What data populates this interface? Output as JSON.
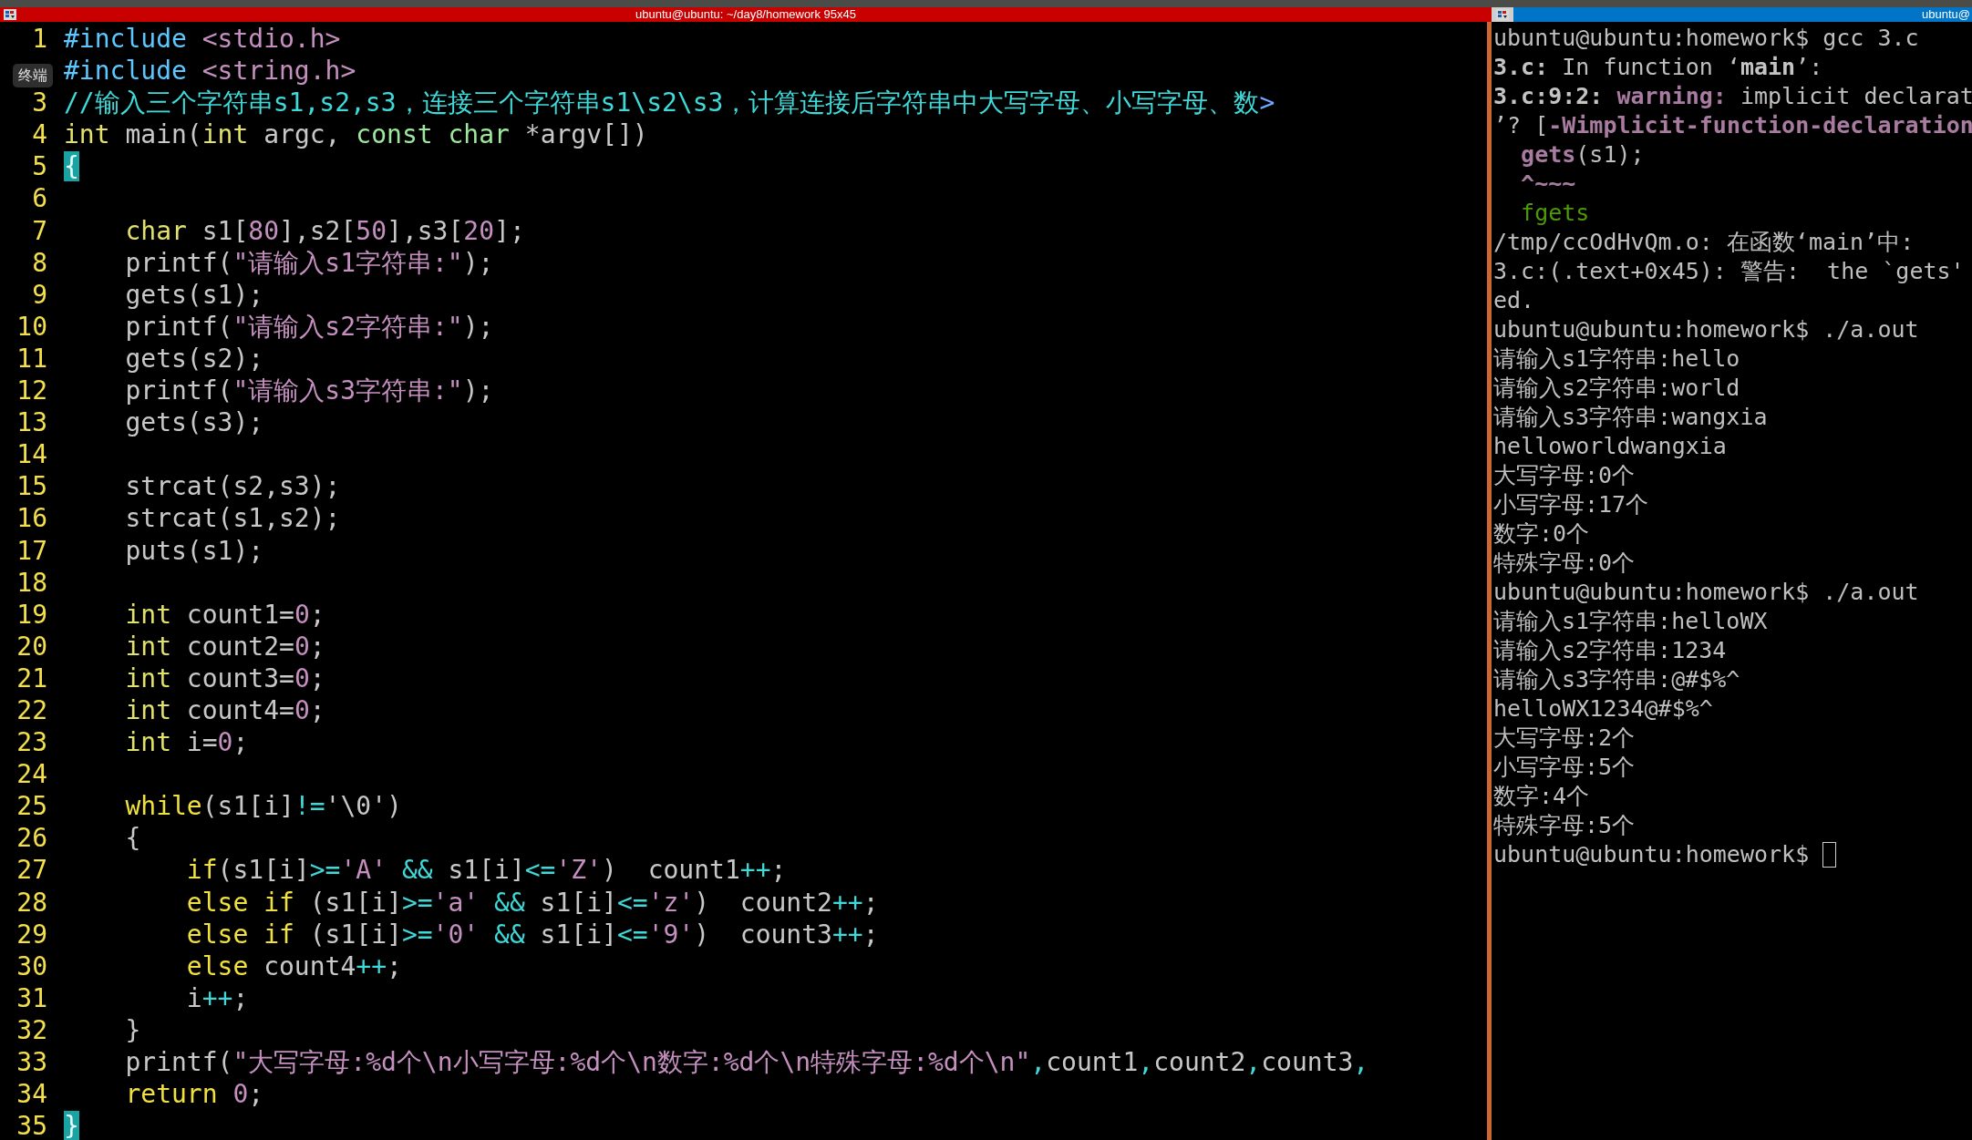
{
  "left_pane": {
    "title": "ubuntu@ubuntu: ~/day8/homework 95x45",
    "tooltip": "终端",
    "lines": [
      {
        "number": "1",
        "current": false,
        "segments": [
          {
            "kind": "pp",
            "text": "#include"
          },
          {
            "kind": "inc",
            "text": " <stdio.h>"
          }
        ]
      },
      {
        "current": false,
        "segments": [
          {
            "kind": "pp",
            "text": "#include"
          },
          {
            "kind": "inc",
            "text": " <string.h>"
          }
        ]
      },
      {
        "number": "3",
        "current": false,
        "segments": [
          {
            "kind": "cm",
            "text": "//输入三个字符串s1,s2,s3，连接三个字符串s1\\s2\\s3，计算连接后字符串中大写字母、小写字母、数"
          },
          {
            "kind": "more",
            "text": ">"
          }
        ]
      },
      {
        "number": "4",
        "current": false,
        "segments": [
          {
            "kind": "ty",
            "text": "int"
          },
          {
            "kind": "plain",
            "text": " main("
          },
          {
            "kind": "ty",
            "text": "int"
          },
          {
            "kind": "plain",
            "text": " argc, "
          },
          {
            "kind": "qual",
            "text": "const"
          },
          {
            "kind": "qual",
            "text": " char"
          },
          {
            "kind": "plain",
            "text": " *argv[])"
          }
        ]
      },
      {
        "number": "5",
        "current": false,
        "segments": [
          {
            "kind": "match",
            "text": "{"
          }
        ]
      },
      {
        "number": "6",
        "current": false
      },
      {
        "number": "7",
        "current": false,
        "segments": [
          {
            "kind": "ty",
            "text": "    char"
          },
          {
            "kind": "plain",
            "text": " s1["
          },
          {
            "kind": "num",
            "text": "80"
          },
          {
            "kind": "plain",
            "text": "],s2["
          },
          {
            "kind": "num",
            "text": "50"
          },
          {
            "kind": "plain",
            "text": "],s3["
          },
          {
            "kind": "num",
            "text": "20"
          },
          {
            "kind": "plain",
            "text": "];"
          }
        ]
      },
      {
        "number": "8",
        "current": false,
        "segments": [
          {
            "kind": "plain",
            "text": "    printf("
          },
          {
            "kind": "str",
            "text": "\"请输入s1字符串:\""
          },
          {
            "kind": "plain",
            "text": ");"
          }
        ]
      },
      {
        "number": "9",
        "current": false,
        "segments": [
          {
            "kind": "plain",
            "text": "    gets(s1);"
          }
        ]
      },
      {
        "number": "10",
        "current": false,
        "segments": [
          {
            "kind": "plain",
            "text": "    printf("
          },
          {
            "kind": "str",
            "text": "\"请输入s2字符串:\""
          },
          {
            "kind": "plain",
            "text": ");"
          }
        ]
      },
      {
        "number": "11",
        "current": false,
        "segments": [
          {
            "kind": "plain",
            "text": "    gets(s2);"
          }
        ]
      },
      {
        "number": "12",
        "current": false,
        "segments": [
          {
            "kind": "plain",
            "text": "    printf("
          },
          {
            "kind": "str",
            "text": "\"请输入s3字符串:\""
          },
          {
            "kind": "plain",
            "text": ");"
          }
        ]
      },
      {
        "number": "13",
        "current": false,
        "segments": [
          {
            "kind": "plain",
            "text": "    gets(s3);"
          }
        ]
      },
      {
        "number": "14",
        "current": false
      },
      {
        "number": "15",
        "current": false,
        "segments": [
          {
            "kind": "plain",
            "text": "    strcat(s2,s3);"
          }
        ]
      },
      {
        "number": "16",
        "current": false,
        "segments": [
          {
            "kind": "plain",
            "text": "    strcat(s1,s2);"
          }
        ]
      },
      {
        "number": "17",
        "current": false,
        "segments": [
          {
            "kind": "plain",
            "text": "    puts(s1);"
          }
        ]
      },
      {
        "number": "18",
        "current": false
      },
      {
        "number": "19",
        "current": false,
        "segments": [
          {
            "kind": "ty",
            "text": "    int"
          },
          {
            "kind": "plain",
            "text": " count1="
          },
          {
            "kind": "num",
            "text": "0"
          },
          {
            "kind": "plain",
            "text": ";"
          }
        ]
      },
      {
        "number": "20",
        "current": false,
        "segments": [
          {
            "kind": "ty",
            "text": "    int"
          },
          {
            "kind": "plain",
            "text": " count2="
          },
          {
            "kind": "num",
            "text": "0"
          },
          {
            "kind": "plain",
            "text": ";"
          }
        ]
      },
      {
        "number": "21",
        "current": false,
        "segments": [
          {
            "kind": "ty",
            "text": "    int"
          },
          {
            "kind": "plain",
            "text": " count3="
          },
          {
            "kind": "num",
            "text": "0"
          },
          {
            "kind": "plain",
            "text": ";"
          }
        ]
      },
      {
        "number": "22",
        "current": false,
        "segments": [
          {
            "kind": "ty",
            "text": "    int"
          },
          {
            "kind": "plain",
            "text": " count4="
          },
          {
            "kind": "num",
            "text": "0"
          },
          {
            "kind": "plain",
            "text": ";"
          }
        ]
      },
      {
        "number": "23",
        "current": false,
        "segments": [
          {
            "kind": "ty",
            "text": "    int"
          },
          {
            "kind": "plain",
            "text": " i="
          },
          {
            "kind": "num",
            "text": "0"
          },
          {
            "kind": "plain",
            "text": ";"
          }
        ]
      },
      {
        "number": "24",
        "current": false
      },
      {
        "number": "25",
        "current": false,
        "segments": [
          {
            "kind": "kw",
            "text": "    while"
          },
          {
            "kind": "plain",
            "text": "(s1[i]"
          },
          {
            "kind": "op",
            "text": "!="
          },
          {
            "kind": "plain",
            "text": "'\\0')"
          }
        ]
      },
      {
        "number": "26",
        "current": false,
        "segments": [
          {
            "kind": "plain",
            "text": "    {"
          }
        ]
      },
      {
        "number": "27",
        "current": false,
        "segments": [
          {
            "kind": "kw",
            "text": "        if"
          },
          {
            "kind": "plain",
            "text": "(s1[i]"
          },
          {
            "kind": "op",
            "text": ">="
          },
          {
            "kind": "str",
            "text": "'A'"
          },
          {
            "kind": "op",
            "text": " &&"
          },
          {
            "kind": "plain",
            "text": " s1[i]"
          },
          {
            "kind": "op",
            "text": "<="
          },
          {
            "kind": "str",
            "text": "'Z'"
          },
          {
            "kind": "plain",
            "text": ")  count1"
          },
          {
            "kind": "op",
            "text": "++"
          },
          {
            "kind": "plain",
            "text": ";"
          }
        ]
      },
      {
        "number": "28",
        "current": false,
        "segments": [
          {
            "kind": "kw",
            "text": "        else"
          },
          {
            "kind": "kw",
            "text": " if"
          },
          {
            "kind": "plain",
            "text": " (s1[i]"
          },
          {
            "kind": "op",
            "text": ">="
          },
          {
            "kind": "str",
            "text": "'a'"
          },
          {
            "kind": "op",
            "text": " &&"
          },
          {
            "kind": "plain",
            "text": " s1[i]"
          },
          {
            "kind": "op",
            "text": "<="
          },
          {
            "kind": "str",
            "text": "'z'"
          },
          {
            "kind": "plain",
            "text": ")  count2"
          },
          {
            "kind": "op",
            "text": "++"
          },
          {
            "kind": "plain",
            "text": ";"
          }
        ]
      },
      {
        "number": "29",
        "current": false,
        "segments": [
          {
            "kind": "kw",
            "text": "        else"
          },
          {
            "kind": "kw",
            "text": " if"
          },
          {
            "kind": "plain",
            "text": " (s1[i]"
          },
          {
            "kind": "op",
            "text": ">="
          },
          {
            "kind": "str",
            "text": "'0'"
          },
          {
            "kind": "op",
            "text": " &&"
          },
          {
            "kind": "plain",
            "text": " s1[i]"
          },
          {
            "kind": "op",
            "text": "<="
          },
          {
            "kind": "str",
            "text": "'9'"
          },
          {
            "kind": "plain",
            "text": ")  count3"
          },
          {
            "kind": "op",
            "text": "++"
          },
          {
            "kind": "plain",
            "text": ";"
          }
        ]
      },
      {
        "number": "30",
        "current": false,
        "segments": [
          {
            "kind": "kw",
            "text": "        else"
          },
          {
            "kind": "plain",
            "text": " count4"
          },
          {
            "kind": "op",
            "text": "++"
          },
          {
            "kind": "plain",
            "text": ";"
          }
        ]
      },
      {
        "number": "31",
        "current": false,
        "segments": [
          {
            "kind": "plain",
            "text": "        i"
          },
          {
            "kind": "op",
            "text": "++"
          },
          {
            "kind": "plain",
            "text": ";"
          }
        ]
      },
      {
        "number": "32",
        "current": false,
        "segments": [
          {
            "kind": "plain",
            "text": "    }"
          }
        ]
      },
      {
        "number": "33",
        "current": false,
        "segments": [
          {
            "kind": "plain",
            "text": "    printf("
          },
          {
            "kind": "str",
            "text": "\"大写字母:%d个\\n小写字母:%d个\\n数字:%d个\\n特殊字母:%d个\\n\""
          },
          {
            "kind": "op",
            "text": ","
          },
          {
            "kind": "plain",
            "text": "count1"
          },
          {
            "kind": "op",
            "text": ","
          },
          {
            "kind": "plain",
            "text": "count2"
          },
          {
            "kind": "op",
            "text": ","
          },
          {
            "kind": "plain",
            "text": "count3"
          },
          {
            "kind": "op",
            "text": ","
          }
        ]
      },
      {
        "number": "34",
        "current": false,
        "segments": [
          {
            "kind": "kw",
            "text": "    return"
          },
          {
            "kind": "num",
            "text": " 0"
          },
          {
            "kind": "plain",
            "text": ";"
          }
        ]
      },
      {
        "number": "35",
        "current": true,
        "segments": [
          {
            "kind": "match",
            "text": "}"
          }
        ]
      }
    ]
  },
  "right_pane": {
    "title": "ubuntu@",
    "cursor_visible": true,
    "lines": [
      [
        {
          "kind": "plain",
          "text": "ubuntu@ubuntu:homework$ gcc 3.c"
        }
      ],
      [
        {
          "kind": "bold",
          "text": "3.c:"
        },
        {
          "kind": "plain",
          "text": " In function ‘"
        },
        {
          "kind": "bold",
          "text": "main"
        },
        {
          "kind": "plain",
          "text": "’:"
        }
      ],
      [
        {
          "kind": "bold",
          "text": "3.c:9:2:"
        },
        {
          "kind": "warn",
          "text": " warning:"
        },
        {
          "kind": "plain",
          "text": " implicit declarat"
        }
      ],
      [
        {
          "kind": "plain",
          "text": "’? ["
        },
        {
          "kind": "warn",
          "text": "-Wimplicit-function-declaration"
        }
      ],
      [
        {
          "kind": "warn",
          "text": "  gets"
        },
        {
          "kind": "plain",
          "text": "(s1);"
        }
      ],
      [
        {
          "kind": "warn",
          "text": "  ^~~~"
        }
      ],
      [
        {
          "kind": "fix",
          "text": "  fgets"
        }
      ],
      [
        {
          "kind": "plain",
          "text": "/tmp/ccOdHvQm.o: 在函数‘main’中:"
        }
      ],
      [
        {
          "kind": "plain",
          "text": "3.c:(.text+0x45): 警告:  the `gets'"
        }
      ],
      [
        {
          "kind": "plain",
          "text": "ed."
        }
      ],
      [
        {
          "kind": "plain",
          "text": "ubuntu@ubuntu:homework$ ./a.out"
        }
      ],
      [
        {
          "kind": "plain",
          "text": "请输入s1字符串:hello"
        }
      ],
      [
        {
          "kind": "plain",
          "text": "请输入s2字符串:world"
        }
      ],
      [
        {
          "kind": "plain",
          "text": "请输入s3字符串:wangxia"
        }
      ],
      [
        {
          "kind": "plain",
          "text": "helloworldwangxia"
        }
      ],
      [
        {
          "kind": "plain",
          "text": "大写字母:0个"
        }
      ],
      [
        {
          "kind": "plain",
          "text": "小写字母:17个"
        }
      ],
      [
        {
          "kind": "plain",
          "text": "数字:0个"
        }
      ],
      [
        {
          "kind": "plain",
          "text": "特殊字母:0个"
        }
      ],
      [
        {
          "kind": "plain",
          "text": "ubuntu@ubuntu:homework$ ./a.out"
        }
      ],
      [
        {
          "kind": "plain",
          "text": "请输入s1字符串:helloWX"
        }
      ],
      [
        {
          "kind": "plain",
          "text": "请输入s2字符串:1234"
        }
      ],
      [
        {
          "kind": "plain",
          "text": "请输入s3字符串:@#$%^"
        }
      ],
      [
        {
          "kind": "plain",
          "text": "helloWX1234@#$%^"
        }
      ],
      [
        {
          "kind": "plain",
          "text": "大写字母:2个"
        }
      ],
      [
        {
          "kind": "plain",
          "text": "小写字母:5个"
        }
      ],
      [
        {
          "kind": "plain",
          "text": "数字:4个"
        }
      ],
      [
        {
          "kind": "plain",
          "text": "特殊字母:5个"
        }
      ],
      [
        {
          "kind": "plain",
          "text": "ubuntu@ubuntu:homework$"
        }
      ]
    ]
  }
}
